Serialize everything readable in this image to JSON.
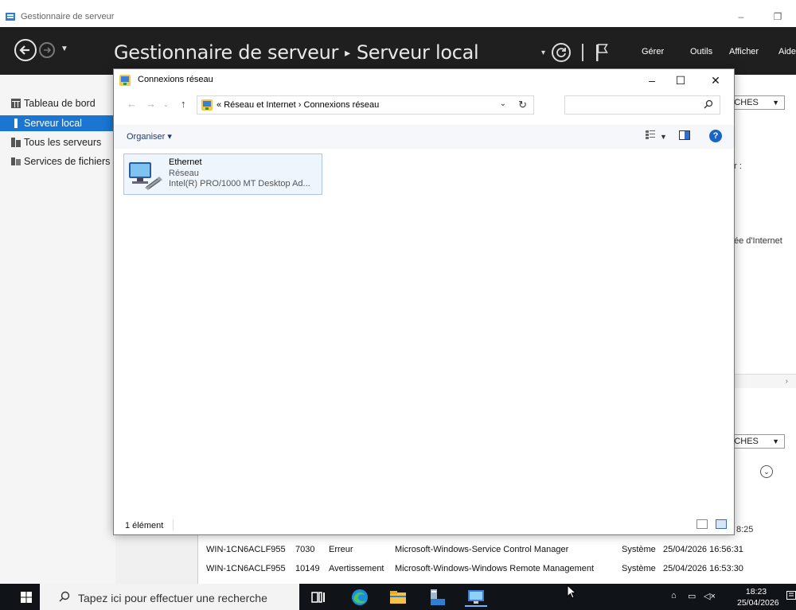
{
  "server_manager": {
    "window_title": "Gestionnaire de serveur",
    "breadcrumb_root": "Gestionnaire de serveur",
    "breadcrumb_sep": "▸",
    "breadcrumb_page": "Serveur local",
    "menu": [
      "Gérer",
      "Outils",
      "Afficher",
      "Aide"
    ],
    "nav_items": [
      {
        "label": "Tableau de bord",
        "active": false
      },
      {
        "label": "Serveur local",
        "active": true
      },
      {
        "label": "Tous les serveurs",
        "active": false
      },
      {
        "label": "Services de fichiers et de stockage",
        "active": false
      }
    ],
    "tasks_label": "ÂCHES",
    "fragment_colon": "r :",
    "fragment_internet": "ée d'Internet",
    "events": [
      {
        "server": "WIN-1CN6ACLF955",
        "id": "7030",
        "severity": "Erreur",
        "source": "Microsoft-Windows-Service Control Manager",
        "log": "Système",
        "date": "25/04/2026 16:56:31"
      },
      {
        "server": "WIN-1CN6ACLF955",
        "id": "10149",
        "severity": "Avertissement",
        "source": "Microsoft-Windows-Windows Remote Management",
        "log": "Système",
        "date": "25/04/2026 16:53:30"
      }
    ],
    "partial_time": "8:25"
  },
  "network_window": {
    "title": "Connexions réseau",
    "minimize": "–",
    "maximize": "☐",
    "close": "✕",
    "address_prefix": "«",
    "address_parent": "Réseau et Internet",
    "address_sep": "›",
    "address_current": "Connexions réseau",
    "search_placeholder": "",
    "organize_label": "Organiser ▾",
    "status_count": "1 élément",
    "adapter": {
      "name": "Ethernet",
      "network": "Réseau",
      "device": "Intel(R) PRO/1000 MT Desktop Ad..."
    }
  },
  "taskbar": {
    "search_placeholder": "Tapez ici pour effectuer une recherche",
    "time": "18:23",
    "date": "25/04/2026"
  }
}
